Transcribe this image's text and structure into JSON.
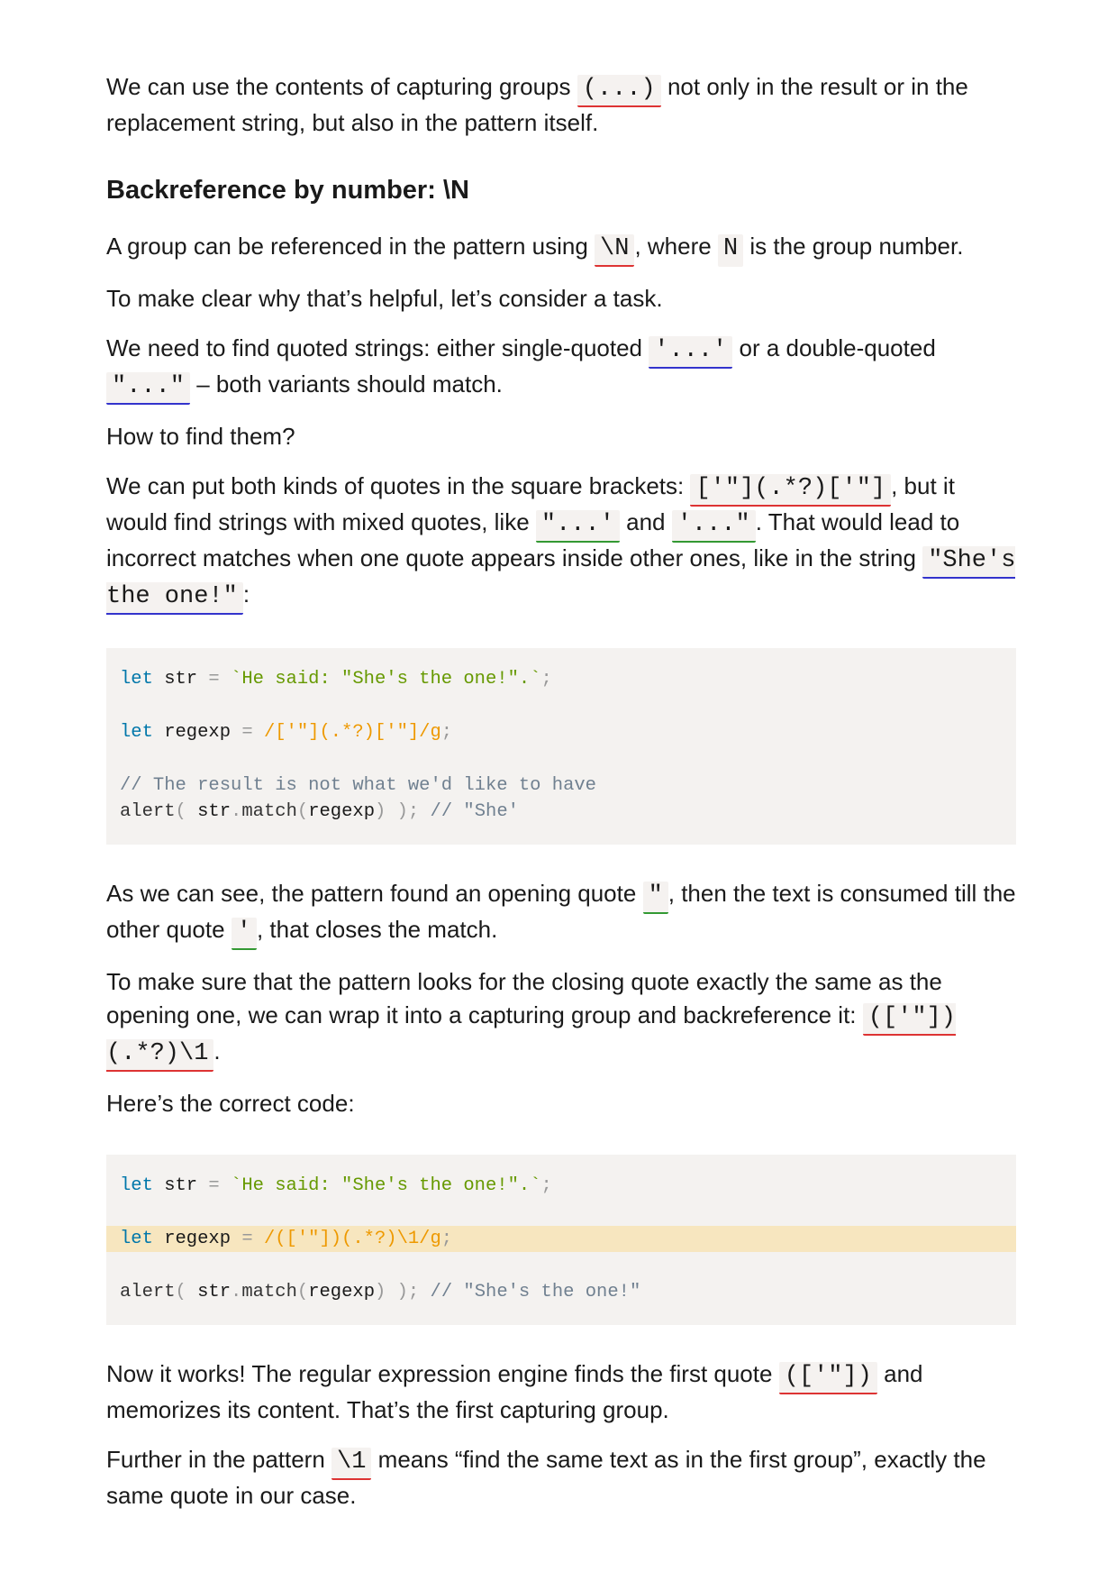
{
  "para1": {
    "t1": "We can use the contents of capturing groups ",
    "c1": "(...)",
    "t2": " not only in the result or in the replacement string, but also in the pattern itself."
  },
  "heading": "Backreference by number: \\N",
  "para2": {
    "t1": "A group can be referenced in the pattern using ",
    "c1": "\\N",
    "t2": ", where ",
    "c2": "N",
    "t3": " is the group number."
  },
  "para3": "To make clear why that’s helpful, let’s consider a task.",
  "para4": {
    "t1": "We need to find quoted strings: either single-quoted ",
    "c1": "'...'",
    "t2": " or a double-quoted ",
    "c2": "\"...\"",
    "t3": " – both variants should match."
  },
  "para5": "How to find them?",
  "para6": {
    "t1": "We can put both kinds of quotes in the square brackets: ",
    "c1": "['\"](.*?)['\"]",
    "t2": ", but it would find strings with mixed quotes, like ",
    "c2": "\"...'",
    "t3": " and ",
    "c3": "'...\"",
    "t4": ". That would lead to incorrect matches when one quote appears inside other ones, like in the string ",
    "c4": "\"She's the one!\"",
    "t5": ":"
  },
  "code1": {
    "l1": {
      "kw": "let",
      "v": " str ",
      "op": "=",
      "s": " `He said: \"She's the one!\".`",
      "p": ";"
    },
    "l2": {
      "kw": "let",
      "v": " regexp ",
      "op": "=",
      "r": " /['\"](.*?)['\"]/g",
      "p": ";"
    },
    "l3": {
      "c": "// The result is not what we'd like to have"
    },
    "l4": {
      "f": "alert",
      "p1": "(",
      "v1": " str",
      "p2": ".",
      "f2": "match",
      "p3": "(",
      "v2": "regexp",
      "p4": ") );",
      "c": " // \"She'"
    }
  },
  "para7": {
    "t1": "As we can see, the pattern found an opening quote ",
    "c1": "\"",
    "t2": ", then the text is consumed till the other quote ",
    "c2": "'",
    "t3": ", that closes the match."
  },
  "para8": {
    "t1": "To make sure that the pattern looks for the closing quote exactly the same as the opening one, we can wrap it into a capturing group and backreference it: ",
    "c1": "(['\"])(.*?)\\1",
    "t2": "."
  },
  "para9": "Here’s the correct code:",
  "code2": {
    "l1": {
      "kw": "let",
      "v": " str ",
      "op": "=",
      "s": " `He said: \"She's the one!\".`",
      "p": ";"
    },
    "l2": {
      "kw": "let",
      "v": " regexp ",
      "op": "=",
      "r": " /(['\"])(.*?)\\1/g",
      "p": ";"
    },
    "l3": {
      "f": "alert",
      "p1": "(",
      "v1": " str",
      "p2": ".",
      "f2": "match",
      "p3": "(",
      "v2": "regexp",
      "p4": ") );",
      "c": " // \"She's the one!\""
    }
  },
  "para10": {
    "t1": "Now it works! The regular expression engine finds the first quote ",
    "c1": "(['\"])",
    "t2": " and memorizes its content. That’s the first capturing group."
  },
  "para11": {
    "t1": "Further in the pattern ",
    "c1": "\\1",
    "t2": " means “find the same text as in the first group”, exactly the same quote in our case."
  }
}
